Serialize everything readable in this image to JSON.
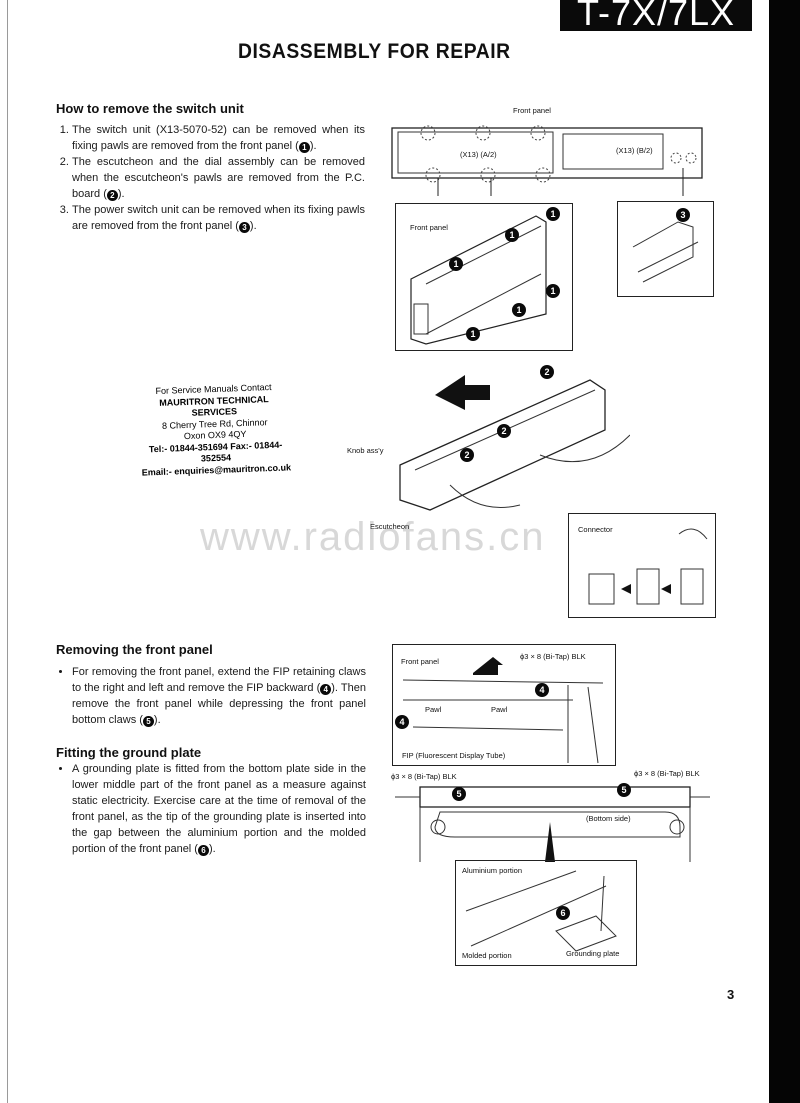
{
  "header": {
    "model": "T-7X/7LX",
    "title": "DISASSEMBLY FOR REPAIR"
  },
  "sections": {
    "switch_unit": {
      "heading": "How to remove the switch unit",
      "steps": [
        {
          "text": "The switch unit (X13-5070-52) can be removed when its fixing pawls are removed from the front panel (",
          "ref": "1",
          "tail": ")."
        },
        {
          "text": "The escutcheon and the dial assembly can be removed when the escutcheon's pawls are removed from the P.C. board (",
          "ref": "2",
          "tail": ")."
        },
        {
          "text": "The power switch unit can be removed when its fixing pawls are removed from the front panel (",
          "ref": "3",
          "tail": ")."
        }
      ]
    },
    "front_panel": {
      "heading": "Removing the front panel",
      "bullet": {
        "text1": "For removing the front panel, extend the FIP retaining claws to the right and left and remove the FIP backward (",
        "ref1": "4",
        "text2": "). Then remove the front panel while depressing the front panel bottom claws (",
        "ref2": "5",
        "tail": ")."
      }
    },
    "ground_plate": {
      "heading": "Fitting the ground plate",
      "bullet": {
        "text": "A grounding plate is fitted from the bottom plate side in the lower middle part of the front panel as a measure against static electricity. Exercise care at the time of removal of the front panel, as the tip of the grounding plate is inserted into the gap between the aluminium portion and the molded portion of the front panel (",
        "ref": "6",
        "tail": ")."
      }
    }
  },
  "contact": {
    "line1": "For Service Manuals Contact",
    "line2": "MAURITRON TECHNICAL SERVICES",
    "line3": "8 Cherry Tree Rd, Chinnor",
    "line4": "Oxon OX9 4QY",
    "line5": "Tel:- 01844-351694 Fax:- 01844-352554",
    "line6": "Email:- enquiries@mauritron.co.uk"
  },
  "watermark": "www.radiofans.cn",
  "diagrams": {
    "top": {
      "front_panel": "Front panel",
      "x13_a": "(X13) (A/2)",
      "x13_b": "(X13) (B/2)",
      "inset_front_panel": "Front panel"
    },
    "escutcheon": {
      "knob": "Knob ass'y",
      "escutcheon": "Escutcheon",
      "connector": "Connector"
    },
    "fip": {
      "front_panel": "Front panel",
      "screw": "ϕ3 × 8 (Bi-Tap) BLK",
      "pawl_left": "Pawl",
      "pawl_right": "Pawl",
      "fip": "FIP (Fluorescent Display Tube)"
    },
    "bottom": {
      "screw_left": "ϕ3 × 8 (Bi-Tap) BLK",
      "screw_right": "ϕ3 × 8 (Bi-Tap) BLK",
      "bottom_side": "(Bottom side)"
    },
    "ground": {
      "aluminium": "Aluminium portion",
      "molded": "Molded portion",
      "grounding": "Grounding plate"
    },
    "badges": [
      "1",
      "2",
      "3",
      "4",
      "5",
      "6"
    ]
  },
  "page_number": "3"
}
